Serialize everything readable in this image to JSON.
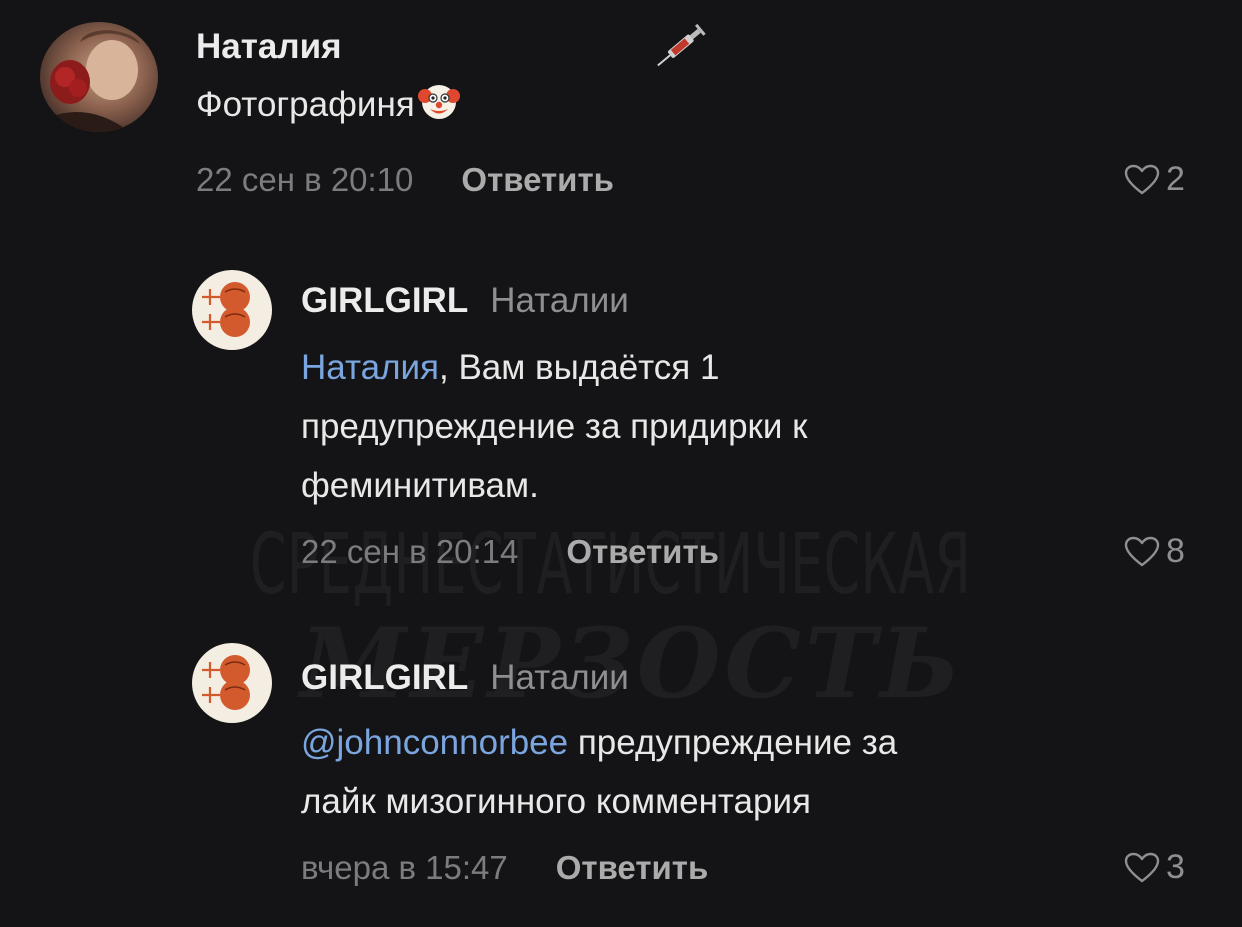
{
  "watermark": {
    "line1": "СРЕДНЕСТАТИСТИЧЕСКАЯ",
    "line2": "МЕРЗОСТЬ"
  },
  "comments": [
    {
      "author": "Наталия",
      "text": "Фотографиня",
      "emoji_icon": "clown-face-icon",
      "status_icon": "syringe-icon",
      "time": "22 сен в 20:10",
      "reply_label": "Ответить",
      "likes": "2"
    },
    {
      "author": "GIRLGIRL",
      "reply_to": "Наталии",
      "mention": "Наталия",
      "text_line1": ", Вам выдаётся 1",
      "text_line2": "предупреждение за придирки к",
      "text_line3": "феминитивам.",
      "time": "22 сен в 20:14",
      "reply_label": "Ответить",
      "likes": "8"
    },
    {
      "author": "GIRLGIRL",
      "reply_to": "Наталии",
      "mention": "@johnconnorbee",
      "text_line1": " предупреждение за",
      "text_line2": "лайк мизогинного комментария",
      "time": "вчера в 15:47",
      "reply_label": "Ответить",
      "likes": "3"
    }
  ],
  "colors": {
    "background": "#141416",
    "mention": "#7aa5de",
    "meta": "#7c7c80",
    "avatar_badge": "#f3ede2",
    "avatar_symbol": "#d35a2c"
  }
}
